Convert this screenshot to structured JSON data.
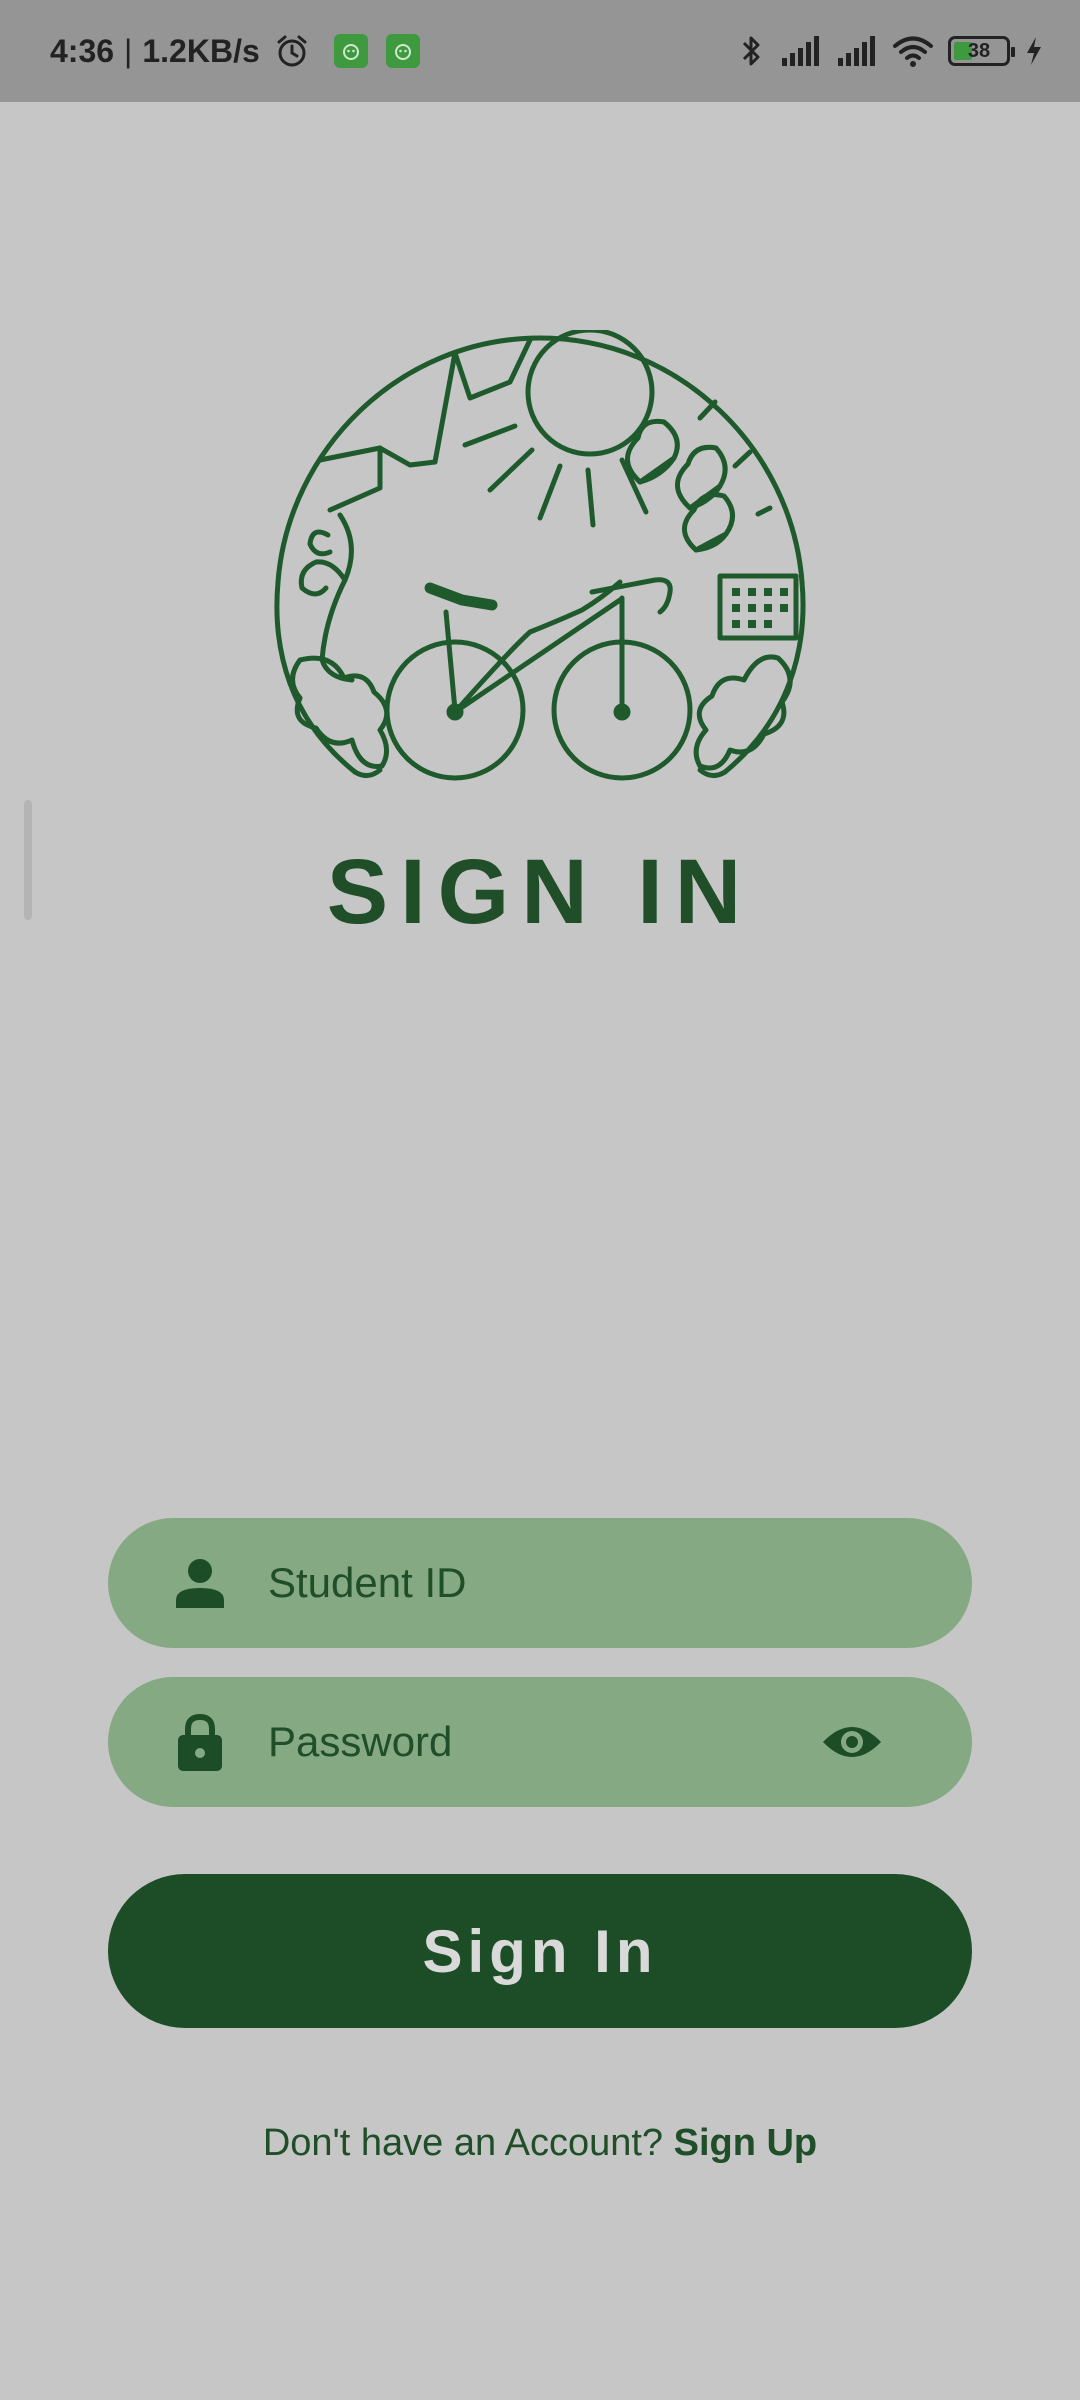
{
  "status_bar": {
    "time": "4:36",
    "separator": "|",
    "network_speed": "1.2KB/s",
    "battery_level": "38",
    "icons": [
      "alarm-icon",
      "app-notification-icon",
      "app-notification-icon",
      "bluetooth-icon",
      "signal-icon",
      "signal-icon",
      "wifi-icon",
      "battery-icon",
      "charging-icon"
    ]
  },
  "logo": {
    "icon": "bicycle-globe-logo"
  },
  "title": "SIGN IN",
  "form": {
    "student_id": {
      "placeholder": "Student ID",
      "value": "",
      "icon": "person-icon"
    },
    "password": {
      "placeholder": "Password",
      "value": "",
      "icon": "lock-icon",
      "toggle_icon": "eye-icon"
    },
    "submit_label": "Sign In"
  },
  "footer": {
    "prompt": "Don't have an Account?",
    "link_label": "Sign Up"
  },
  "colors": {
    "background": "#c6c6c6",
    "status_bar": "#959595",
    "primary": "#1c4d27",
    "field": "#84a983",
    "button_text": "#d9d9d9"
  }
}
